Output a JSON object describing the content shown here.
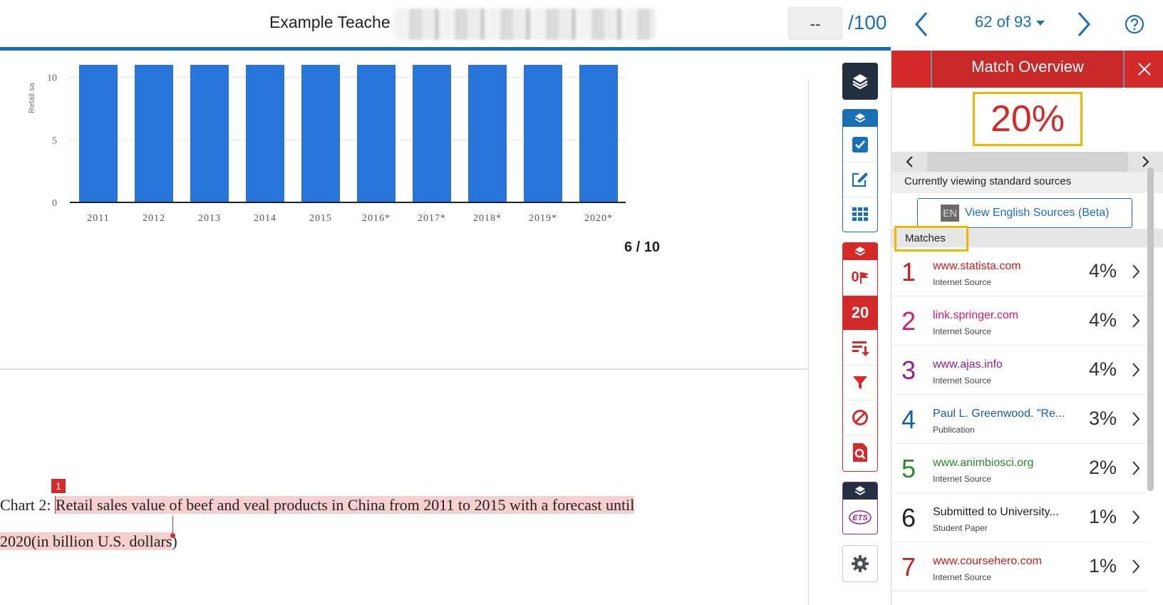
{
  "header": {
    "doc_title": "Example Teache",
    "score_value": "--",
    "score_total": "/100",
    "paper_counter": "62 of 93",
    "colors": {
      "accent": "#1b6fb4"
    }
  },
  "document": {
    "page_indicator": "6 / 10",
    "caption_prefix": "Chart 2: ",
    "caption_highlighted_line1": "Retail sales value of beef and veal products in China from 2011 to 2015 with a forecast until",
    "caption_highlighted_line2": "2020(in billion U.S. dollars",
    "caption_trailing": ")",
    "match_marker": "1"
  },
  "chart_data": {
    "type": "bar",
    "categories": [
      "2011",
      "2012",
      "2013",
      "2014",
      "2015",
      "2016*",
      "2017*",
      "2018*",
      "2019*",
      "2020*"
    ],
    "values": [
      11,
      11,
      11,
      11,
      11,
      11,
      11,
      11,
      11,
      11
    ],
    "yticks": [
      0,
      5,
      10
    ],
    "ylim": [
      0,
      11
    ],
    "ylabel": "Retail sa",
    "grid": true,
    "bar_color": "#2774db",
    "title": "",
    "xlabel": ""
  },
  "toolbar": {
    "flag_count": "0",
    "overall_score": "20",
    "ets_label": "ETS",
    "icons": [
      "layers-icon",
      "check-icon",
      "edit-icon",
      "grid-icon",
      "layers-icon",
      "flag-icon",
      "sort-icon",
      "filter-icon",
      "block-icon",
      "search-doc-icon",
      "layers-icon",
      "ets-icon",
      "gear-icon"
    ]
  },
  "panel": {
    "title": "Match Overview",
    "overall_percent": "20%",
    "viewing_text": "Currently viewing standard sources",
    "en_badge": "EN",
    "en_button_label": "View English Sources (Beta)",
    "matches_label": "Matches",
    "matches": [
      {
        "num": "1",
        "source": "www.statista.com",
        "type": "Internet Source",
        "percent": "4%",
        "color": "#c41e1e"
      },
      {
        "num": "2",
        "source": "link.springer.com",
        "type": "Internet Source",
        "percent": "4%",
        "color": "#d6196e"
      },
      {
        "num": "3",
        "source": "www.ajas.info",
        "type": "Internet Source",
        "percent": "4%",
        "color": "#8e1f8e"
      },
      {
        "num": "4",
        "source": "Paul L. Greenwood. \"Re...",
        "type": "Publication",
        "percent": "3%",
        "color": "#1760a8"
      },
      {
        "num": "5",
        "source": "www.animbiosci.org",
        "type": "Internet Source",
        "percent": "2%",
        "color": "#2a8a2a"
      },
      {
        "num": "6",
        "source": "Submitted to University...",
        "type": "Student Paper",
        "percent": "1%",
        "color": "#222222"
      },
      {
        "num": "7",
        "source": "www.coursehero.com",
        "type": "Internet Source",
        "percent": "1%",
        "color": "#c41e1e"
      }
    ],
    "colors": {
      "header": "#d42a2a",
      "highlight_box": "#f6b300"
    }
  }
}
